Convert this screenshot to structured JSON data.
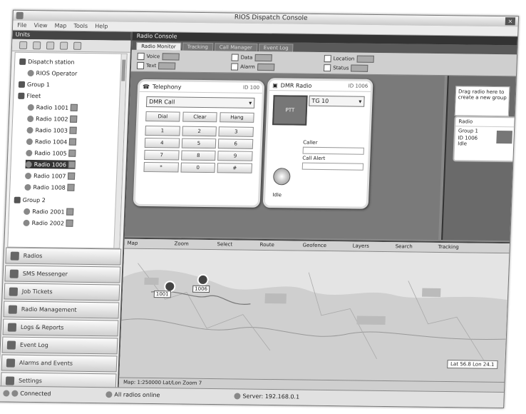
{
  "window": {
    "title": "RIOS Dispatch Console"
  },
  "menu": [
    "File",
    "View",
    "Map",
    "Tools",
    "Help"
  ],
  "left_panel": {
    "header": "Units",
    "tree": [
      {
        "label": "Dispatch station",
        "level": 0
      },
      {
        "label": "RIOS Operator",
        "level": 1
      },
      {
        "label": "Group 1",
        "level": 0
      },
      {
        "label": "Fleet",
        "level": 0
      },
      {
        "label": "Radio 1001",
        "level": 2
      },
      {
        "label": "Radio 1002",
        "level": 2
      },
      {
        "label": "Radio 1003",
        "level": 2
      },
      {
        "label": "Radio 1004",
        "level": 2
      },
      {
        "label": "Radio 1005",
        "level": 2
      },
      {
        "label": "Radio 1006",
        "level": 2,
        "selected": true
      },
      {
        "label": "Radio 1007",
        "level": 2
      },
      {
        "label": "Radio 1008",
        "level": 2
      },
      {
        "label": "Group 2",
        "level": 0
      },
      {
        "label": "Radio 2001",
        "level": 2
      },
      {
        "label": "Radio 2002",
        "level": 2
      }
    ],
    "nav": [
      "Radios",
      "SMS Messenger",
      "Job Tickets",
      "Radio Management",
      "Logs & Reports",
      "Event Log",
      "Alarms and Events",
      "Settings"
    ]
  },
  "main": {
    "header": "Radio Console",
    "tabs": [
      "Radio Monitor",
      "Tracking",
      "Call Manager",
      "Event Log"
    ],
    "filters": [
      "Voice",
      "Text",
      "Data",
      "Alarm",
      "Location",
      "Status"
    ],
    "card_phone": {
      "title": "Telephony",
      "id": "ID 100",
      "select_value": "DMR Call",
      "buttons": [
        "Dial",
        "Clear",
        "Hang"
      ],
      "keys": [
        "1",
        "2",
        "3",
        "4",
        "5",
        "6",
        "7",
        "8",
        "9",
        "*",
        "0",
        "#"
      ]
    },
    "card_radio": {
      "title": "DMR Radio",
      "id": "ID 1006",
      "select_value": "TG 10",
      "ptt_label": "PTT",
      "fields": [
        "Caller",
        "Call Alert"
      ],
      "footer": "Idle"
    },
    "right": {
      "banner": "Drag radio here to create a new group",
      "mini_title": "Radio",
      "mini_lines": [
        "Group 1",
        "ID 1006",
        "Idle"
      ]
    }
  },
  "map": {
    "toolbar": [
      "Map",
      "Zoom",
      "Select",
      "Route",
      "Geofence",
      "Layers",
      "Search",
      "Tracking"
    ],
    "units": [
      "1001",
      "1006"
    ],
    "coords": "Lat 56.8 Lon 24.1",
    "status": "Map: 1:250000   Lat/Lon   Zoom 7"
  },
  "statusbar": [
    "Connected",
    "All radios online",
    "Server: 192.168.0.1"
  ]
}
